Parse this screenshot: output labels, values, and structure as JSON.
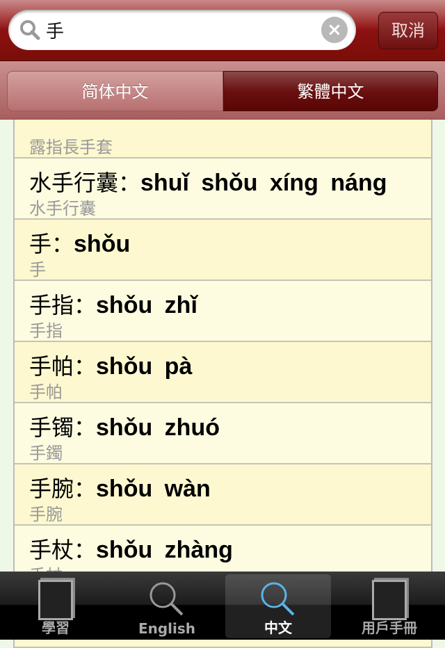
{
  "search": {
    "value": "手",
    "cancel_label": "取消"
  },
  "segments": [
    {
      "label": "简体中文",
      "selected": false
    },
    {
      "label": "繁體中文",
      "selected": true
    }
  ],
  "results": [
    {
      "hanzi": "",
      "pinyin": "",
      "sub": "露指長手套"
    },
    {
      "hanzi": "水手行囊：",
      "pinyin": "shuǐ shǒu xíng náng",
      "sub": "水手行囊"
    },
    {
      "hanzi": "手：",
      "pinyin": "shǒu",
      "sub": "手"
    },
    {
      "hanzi": "手指：",
      "pinyin": "shǒu zhǐ",
      "sub": "手指"
    },
    {
      "hanzi": "手帕：",
      "pinyin": "shǒu pà",
      "sub": "手帕"
    },
    {
      "hanzi": "手镯：",
      "pinyin": "shǒu zhuó",
      "sub": "手鐲"
    },
    {
      "hanzi": "手腕：",
      "pinyin": "shǒu wàn",
      "sub": "手腕"
    },
    {
      "hanzi": "手杖：",
      "pinyin": "shǒu zhàng",
      "sub": "手杖"
    },
    {
      "hanzi": "",
      "pinyin": "",
      "sub": ""
    }
  ],
  "tabs": [
    {
      "label": "學習",
      "icon": "document-icon"
    },
    {
      "label": "English",
      "icon": "search-icon"
    },
    {
      "label": "中文",
      "icon": "search-icon",
      "selected": true
    },
    {
      "label": "用戶手冊",
      "icon": "documents-icon"
    }
  ],
  "colors": {
    "accent": "#7a0e08",
    "selected_tab_icon": "#5ab4e8"
  }
}
